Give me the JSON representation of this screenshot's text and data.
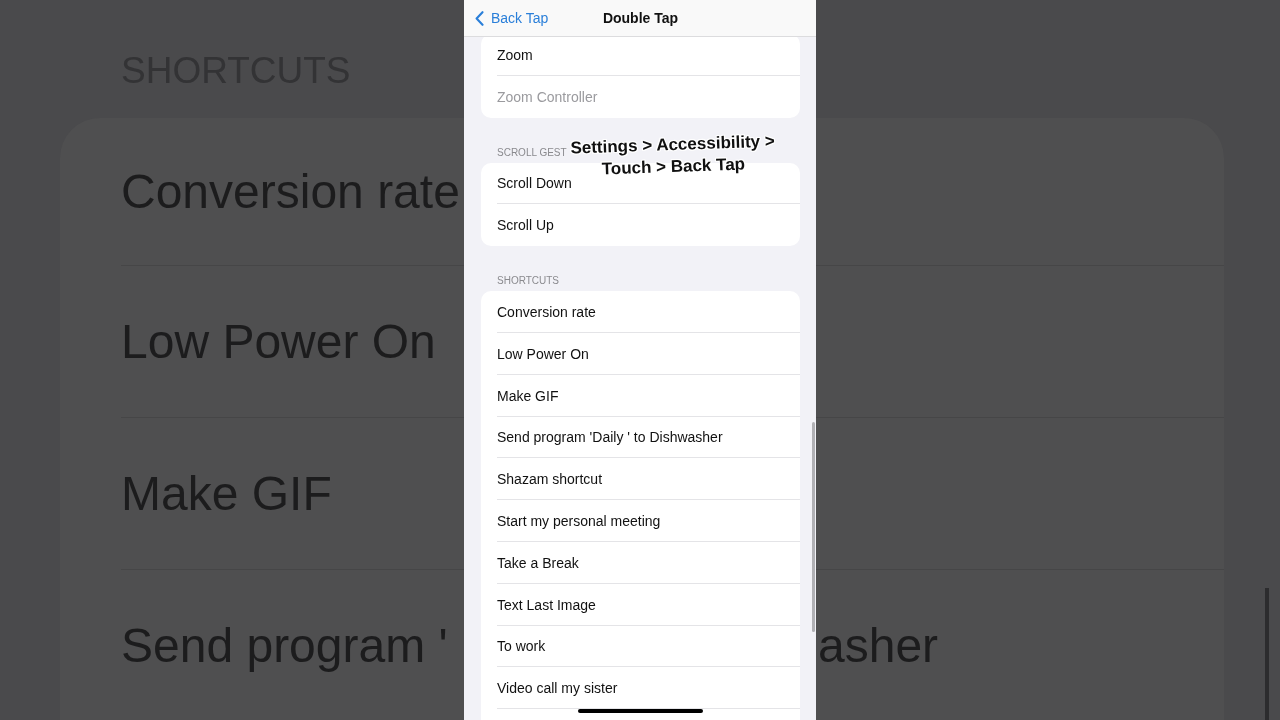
{
  "backdrop": {
    "header": "SHORTCUTS",
    "rows": [
      {
        "label": "Conversion rate"
      },
      {
        "label": "Low Power On"
      },
      {
        "label": "Make GIF"
      },
      {
        "label": "Send program '",
        "tail": "asher"
      }
    ]
  },
  "nav_bar": {
    "back_label": "Back Tap",
    "title": "Double Tap"
  },
  "sections": [
    {
      "rows": [
        {
          "label": "Zoom",
          "disabled": false
        },
        {
          "label": "Zoom Controller",
          "disabled": true
        }
      ]
    },
    {
      "header": "SCROLL GEST",
      "rows": [
        {
          "label": "Scroll Down",
          "disabled": false
        },
        {
          "label": "Scroll Up",
          "disabled": false
        }
      ]
    },
    {
      "header": "SHORTCUTS",
      "rows": [
        {
          "label": "Conversion rate",
          "disabled": false
        },
        {
          "label": "Low Power On",
          "disabled": false
        },
        {
          "label": "Make GIF",
          "disabled": false
        },
        {
          "label": "Send program 'Daily ' to Dishwasher",
          "disabled": false
        },
        {
          "label": "Shazam shortcut",
          "disabled": false
        },
        {
          "label": "Start my personal meeting",
          "disabled": false
        },
        {
          "label": "Take a Break",
          "disabled": false
        },
        {
          "label": "Text Last Image",
          "disabled": false
        },
        {
          "label": "To work",
          "disabled": false
        },
        {
          "label": "Video call my sister",
          "disabled": false
        }
      ]
    }
  ],
  "caption": {
    "lines": [
      "Settings > Accessibility >",
      "Touch > Back Tap"
    ]
  }
}
